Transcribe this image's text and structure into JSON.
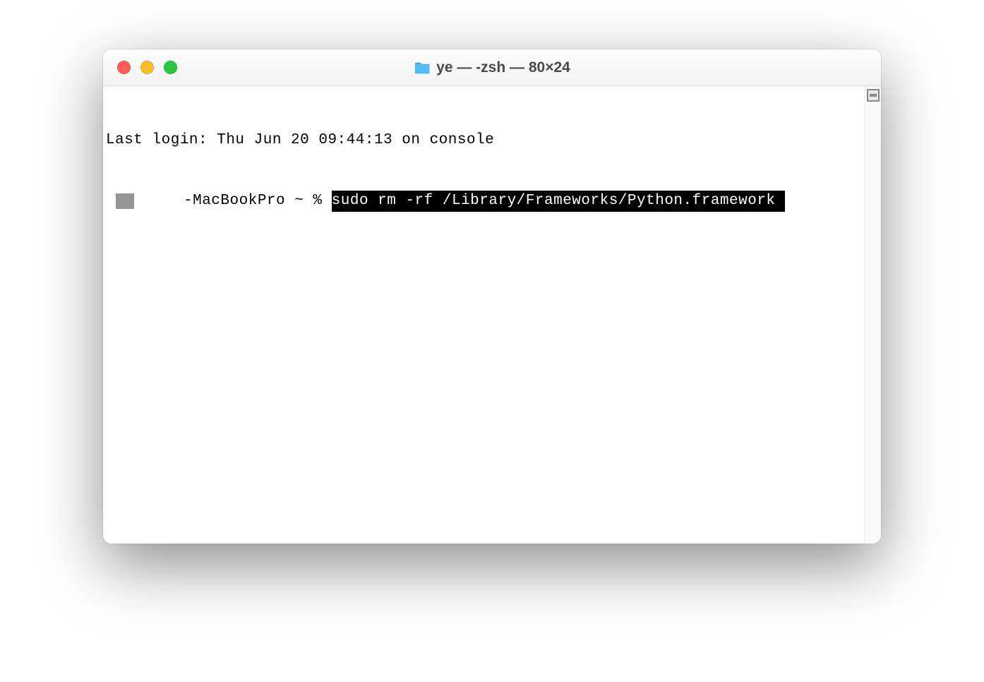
{
  "window": {
    "title": "ye — -zsh — 80×24"
  },
  "terminal": {
    "last_login_line": "Last login: Thu Jun 20 09:44:13 on console",
    "prompt_prefix": "-MacBookPro ~ % ",
    "command_highlighted": "sudo rm -rf /Library/Frameworks/Python.framework "
  },
  "icons": {
    "folder": "folder-icon"
  }
}
